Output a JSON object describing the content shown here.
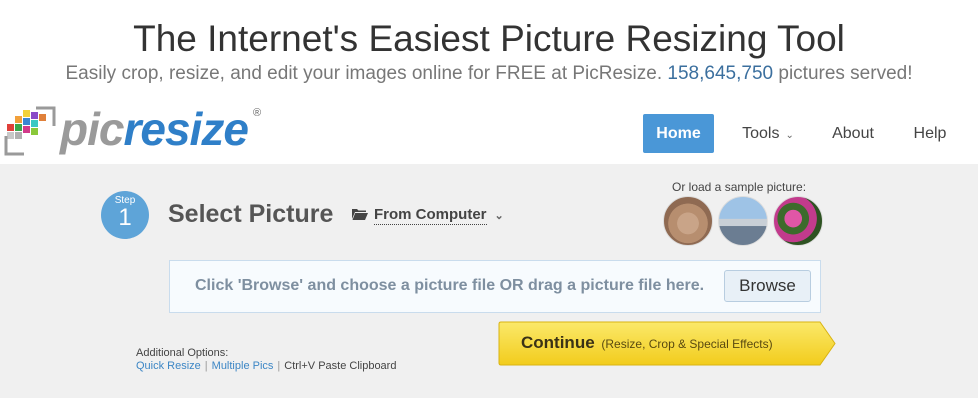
{
  "hero": {
    "title": "The Internet's Easiest Picture Resizing Tool",
    "subtitle_prefix": "Easily crop, resize, and edit your images online for FREE at PicResize.",
    "count": "158,645,750",
    "subtitle_suffix": "pictures served!"
  },
  "logo": {
    "pic": "pic",
    "resize": "resize",
    "registered": "®"
  },
  "nav": {
    "home": "Home",
    "tools": "Tools",
    "about": "About",
    "help": "Help"
  },
  "step": {
    "label": "Step",
    "number": "1",
    "title": "Select Picture",
    "source": "From Computer"
  },
  "samples": {
    "label": "Or load a sample picture:",
    "items": [
      "dog-photo",
      "city-photo",
      "flower-photo"
    ]
  },
  "dropzone": {
    "message": "Click 'Browse' and choose a picture file OR drag a picture file here.",
    "browse": "Browse"
  },
  "continue": {
    "label": "Continue",
    "detail": "(Resize, Crop & Special Effects)"
  },
  "additional": {
    "heading": "Additional Options:",
    "quick_resize": "Quick Resize",
    "multiple_pics": "Multiple Pics",
    "paste": "Ctrl+V Paste Clipboard"
  },
  "colors": {
    "accent": "#4a97d7",
    "brand_blue": "#2f7fc8",
    "continue_yellow": "#f5d327",
    "background_gray": "#f0f0f0"
  }
}
